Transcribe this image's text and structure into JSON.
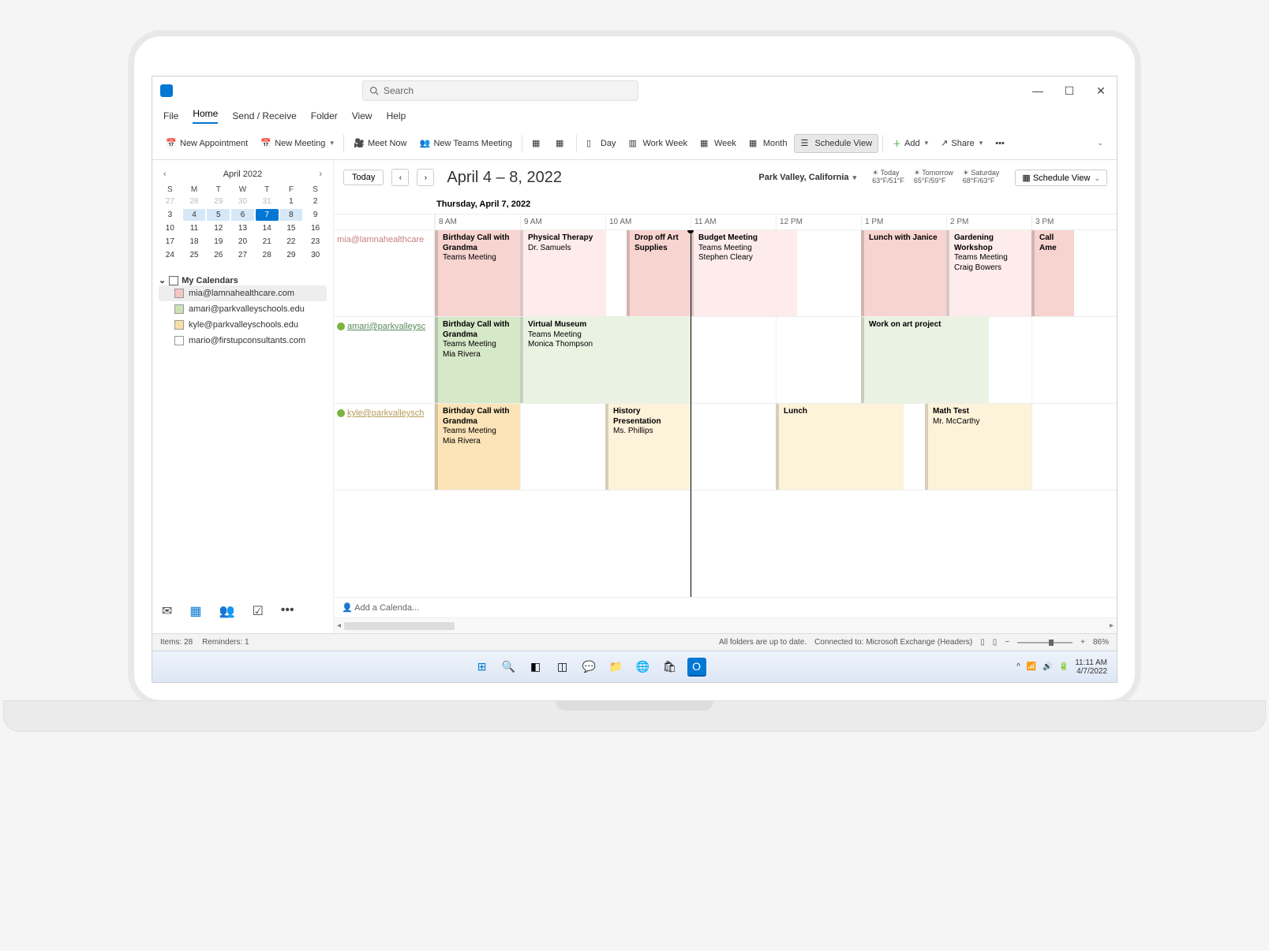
{
  "search": {
    "placeholder": "Search"
  },
  "menu": {
    "file": "File",
    "home": "Home",
    "sendreceive": "Send / Receive",
    "folder": "Folder",
    "view": "View",
    "help": "Help"
  },
  "ribbon": {
    "new_appointment": "New Appointment",
    "new_meeting": "New Meeting",
    "meet_now": "Meet Now",
    "new_teams": "New Teams Meeting",
    "day": "Day",
    "work_week": "Work Week",
    "week": "Week",
    "month": "Month",
    "schedule_view": "Schedule View",
    "add": "Add",
    "share": "Share"
  },
  "mini": {
    "title": "April 2022",
    "dow": [
      "S",
      "M",
      "T",
      "W",
      "T",
      "F",
      "S"
    ],
    "rows": [
      [
        "27",
        "28",
        "29",
        "30",
        "31",
        "1",
        "2"
      ],
      [
        "3",
        "4",
        "5",
        "6",
        "7",
        "8",
        "9"
      ],
      [
        "10",
        "11",
        "12",
        "13",
        "14",
        "15",
        "16"
      ],
      [
        "17",
        "18",
        "19",
        "20",
        "21",
        "22",
        "23"
      ],
      [
        "24",
        "25",
        "26",
        "27",
        "28",
        "29",
        "30"
      ]
    ]
  },
  "calendars": {
    "header": "My Calendars",
    "items": [
      {
        "label": "mia@lamnahealthcare.com",
        "color": "#f3c6c1",
        "checked": true,
        "sel": true
      },
      {
        "label": "amari@parkvalleyschools.edu",
        "color": "#c9e2b5",
        "checked": true
      },
      {
        "label": "kyle@parkvalleyschools.edu",
        "color": "#f7dfa6",
        "checked": true
      },
      {
        "label": "mario@firstupconsultants.com",
        "color": "#ffffff",
        "checked": false
      }
    ]
  },
  "datebar": {
    "today": "Today",
    "title": "April 4 – 8, 2022",
    "location": "Park Valley, California",
    "weather": [
      {
        "name": "Today",
        "temp": "63°F/51°F"
      },
      {
        "name": "Tomorrow",
        "temp": "65°F/59°F"
      },
      {
        "name": "Saturday",
        "temp": "68°F/63°F"
      }
    ],
    "view": "Schedule View"
  },
  "schedule": {
    "day_label": "Thursday, April 7, 2022",
    "hours": [
      "8 AM",
      "9 AM",
      "10 AM",
      "11 AM",
      "12 PM",
      "1 PM",
      "2 PM",
      "3 PM"
    ],
    "now_hour_index": 3,
    "rows": [
      {
        "label": "mia@lamnahealthcare",
        "cls": "",
        "status": "",
        "events": [
          {
            "start": 0,
            "span": 1,
            "cls": "pink",
            "title": "Birthday Call with Grandma",
            "sub": "Teams Meeting"
          },
          {
            "start": 1,
            "span": 1,
            "cls": "pink-l",
            "title": "Physical Therapy",
            "sub": "Dr. Samuels"
          },
          {
            "start": 2.25,
            "span": 0.75,
            "cls": "pink",
            "title": "Drop off Art Supplies",
            "sub": ""
          },
          {
            "start": 3,
            "span": 1.25,
            "cls": "pink-l",
            "title": "Budget Meeting",
            "sub": "Teams Meeting\nStephen Cleary"
          },
          {
            "start": 5,
            "span": 1,
            "cls": "pink",
            "title": "Lunch with Janice",
            "sub": ""
          },
          {
            "start": 6,
            "span": 1,
            "cls": "pink-l",
            "title": "Gardening Workshop",
            "sub": "Teams Meeting\nCraig Bowers"
          },
          {
            "start": 7,
            "span": 0.5,
            "cls": "pink",
            "title": "Call Ame",
            "sub": ""
          }
        ]
      },
      {
        "label": "amari@parkvalleysc",
        "cls": "g",
        "status": "green",
        "events": [
          {
            "start": 0,
            "span": 1,
            "cls": "green",
            "title": "Birthday Call with Grandma",
            "sub": "Teams Meeting\nMia Rivera"
          },
          {
            "start": 1,
            "span": 2,
            "cls": "green-l",
            "title": "Virtual Museum",
            "sub": "Teams Meeting\nMonica Thompson"
          },
          {
            "start": 5,
            "span": 1.5,
            "cls": "green-l",
            "title": "Work on art project",
            "sub": ""
          }
        ]
      },
      {
        "label": "kyle@parkvalleysch",
        "cls": "y",
        "status": "green",
        "events": [
          {
            "start": 0,
            "span": 1,
            "cls": "yellow",
            "title": "Birthday Call with Grandma",
            "sub": "Teams Meeting\nMia Rivera"
          },
          {
            "start": 2,
            "span": 1,
            "cls": "yellow-l",
            "title": "History Presentation",
            "sub": "Ms. Phillips"
          },
          {
            "start": 4,
            "span": 1.5,
            "cls": "yellow-l",
            "title": "Lunch",
            "sub": ""
          },
          {
            "start": 5.75,
            "span": 1.25,
            "cls": "yellow-l",
            "title": "Math Test",
            "sub": "Mr. McCarthy"
          }
        ]
      }
    ],
    "add_calendar": "Add a Calenda..."
  },
  "status": {
    "items": "Items: 28",
    "reminders": "Reminders: 1",
    "sync": "All folders are up to date.",
    "conn": "Connected to: Microsoft Exchange (Headers)",
    "zoom": "86%"
  },
  "tray": {
    "time": "11:11 AM",
    "date": "4/7/2022"
  }
}
